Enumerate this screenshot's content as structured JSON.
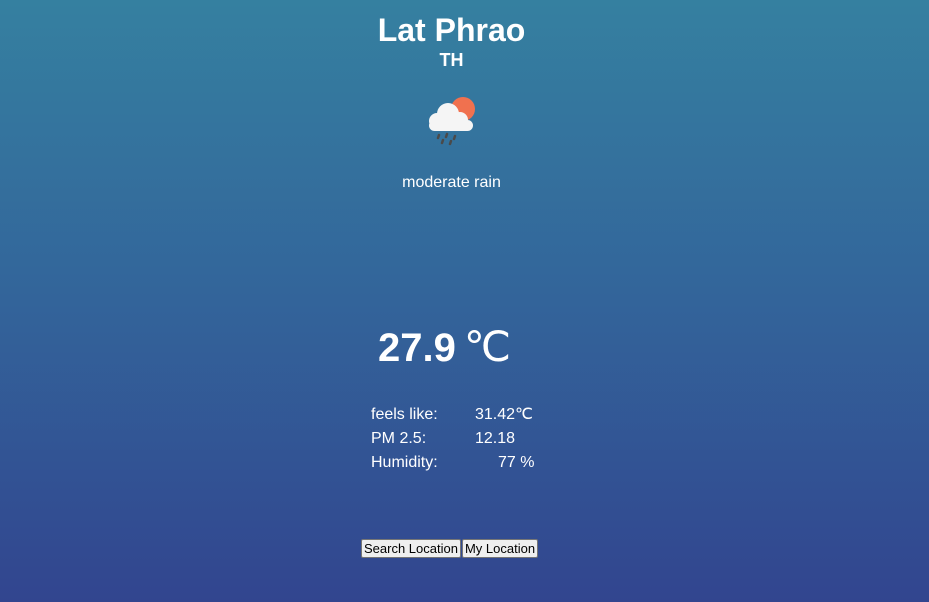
{
  "location": {
    "city": "Lat Phrao",
    "country": "TH"
  },
  "weather": {
    "icon": "rain-cloud-sun-icon",
    "description": "moderate rain",
    "temperature": "27.9",
    "unit": "℃"
  },
  "details": [
    {
      "label": "feels like:",
      "value": "31.42℃"
    },
    {
      "label": "PM 2.5:",
      "value": "12.18"
    },
    {
      "label": "Humidity:",
      "value": "77 %"
    }
  ],
  "buttons": {
    "search_label": "Search Location",
    "my_location_label": "My Location"
  },
  "colors": {
    "background_top": "#3580a0",
    "background_bottom": "#32458f",
    "sun": "#f0714f",
    "cloud": "#f5f5f5",
    "rain": "#4a4a4a"
  }
}
